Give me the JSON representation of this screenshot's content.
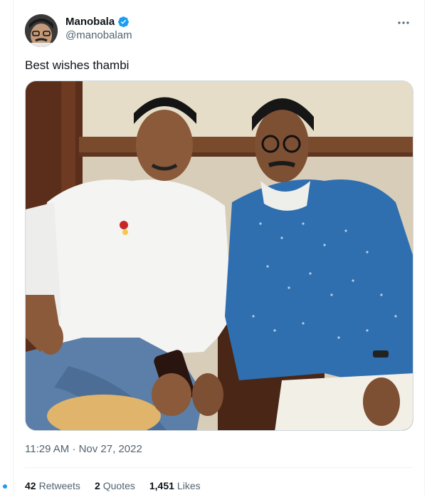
{
  "tweet": {
    "display_name": "Manobala",
    "handle": "@manobalam",
    "verified": true,
    "more_icon": "more-horizontal-icon",
    "text": "Best wishes thambi",
    "timestamp": "11:29 AM · Nov 27, 2022"
  },
  "stats": [
    {
      "count": "42",
      "label": "Retweets"
    },
    {
      "count": "2",
      "label": "Quotes"
    },
    {
      "count": "1,451",
      "label": "Likes"
    }
  ],
  "colors": {
    "verified_badge": "#1d9bf0",
    "text_primary": "#0f1419",
    "text_secondary": "#536471",
    "border": "#cfd9de"
  }
}
